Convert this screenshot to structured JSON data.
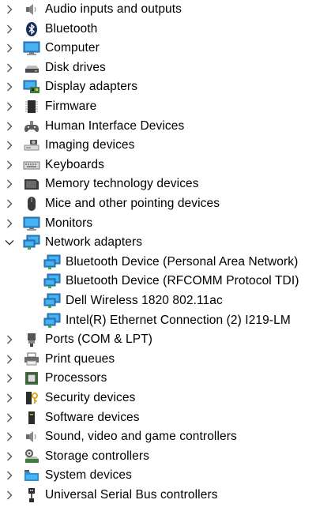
{
  "window": {
    "title": ""
  },
  "tree": {
    "categories": [
      {
        "label": "Audio inputs and outputs",
        "icon": "speaker-icon",
        "expanded": false
      },
      {
        "label": "Bluetooth",
        "icon": "bluetooth-icon",
        "expanded": false
      },
      {
        "label": "Computer",
        "icon": "computer-monitor-icon",
        "expanded": false
      },
      {
        "label": "Disk drives",
        "icon": "disk-drive-icon",
        "expanded": false
      },
      {
        "label": "Display adapters",
        "icon": "display-adapter-icon",
        "expanded": false
      },
      {
        "label": "Firmware",
        "icon": "firmware-chip-icon",
        "expanded": false
      },
      {
        "label": "Human Interface Devices",
        "icon": "hid-icon",
        "expanded": false
      },
      {
        "label": "Imaging devices",
        "icon": "camera-icon",
        "expanded": false
      },
      {
        "label": "Keyboards",
        "icon": "keyboard-icon",
        "expanded": false
      },
      {
        "label": "Memory technology devices",
        "icon": "memory-card-icon",
        "expanded": false
      },
      {
        "label": "Mice and other pointing devices",
        "icon": "mouse-icon",
        "expanded": false
      },
      {
        "label": "Monitors",
        "icon": "monitor-icon",
        "expanded": false
      },
      {
        "label": "Network adapters",
        "icon": "network-adapter-icon",
        "expanded": true,
        "children": [
          {
            "label": "Bluetooth Device (Personal Area Network)",
            "icon": "network-adapter-icon"
          },
          {
            "label": "Bluetooth Device (RFCOMM Protocol TDI)",
            "icon": "network-adapter-icon"
          },
          {
            "label": "Dell Wireless 1820 802.11ac",
            "icon": "network-adapter-icon"
          },
          {
            "label": "Intel(R) Ethernet Connection (2) I219-LM",
            "icon": "network-adapter-icon"
          }
        ]
      },
      {
        "label": "Ports (COM & LPT)",
        "icon": "port-icon",
        "expanded": false
      },
      {
        "label": "Print queues",
        "icon": "printer-icon",
        "expanded": false
      },
      {
        "label": "Processors",
        "icon": "processor-icon",
        "expanded": false
      },
      {
        "label": "Security devices",
        "icon": "security-key-icon",
        "expanded": false
      },
      {
        "label": "Software devices",
        "icon": "software-device-icon",
        "expanded": false
      },
      {
        "label": "Sound, video and game controllers",
        "icon": "speaker-icon",
        "expanded": false
      },
      {
        "label": "Storage controllers",
        "icon": "storage-controller-icon",
        "expanded": false
      },
      {
        "label": "System devices",
        "icon": "system-folder-icon",
        "expanded": false
      },
      {
        "label": "Universal Serial Bus controllers",
        "icon": "usb-icon",
        "expanded": false
      }
    ]
  }
}
